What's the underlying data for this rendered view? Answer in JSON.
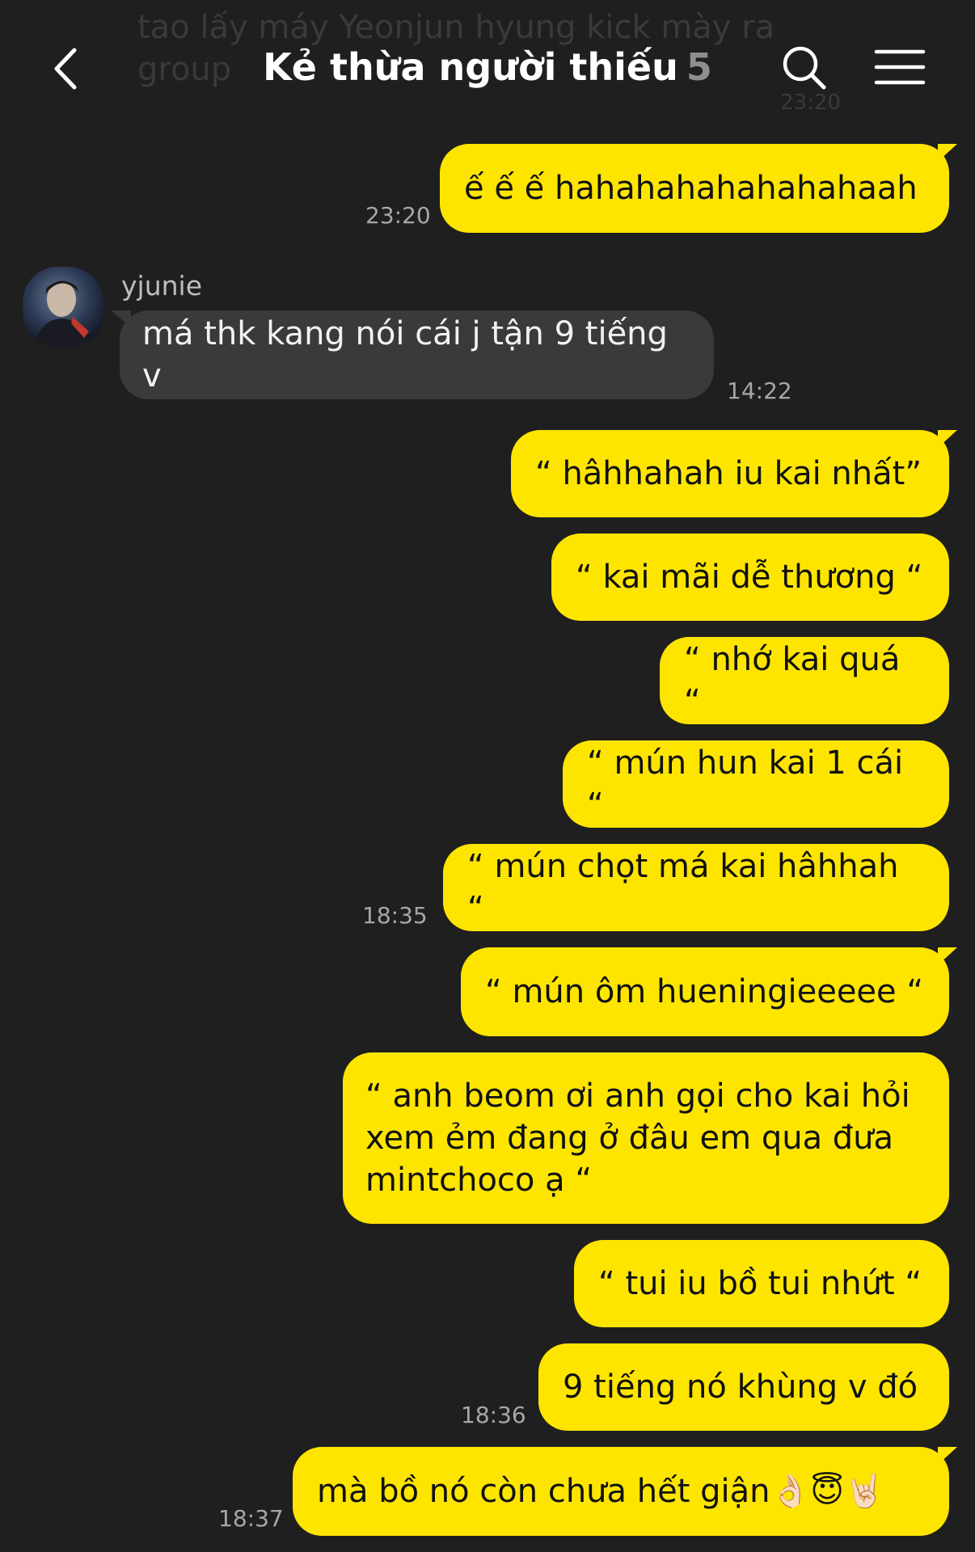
{
  "header": {
    "title": "Kẻ thừa người thiếu",
    "member_count": "5",
    "ghost_text": "tao lấy máy Yeonjun hyung kick mày ra group",
    "ghost_time": "23:20"
  },
  "colors": {
    "background": "#1f1f1f",
    "bubble_out": "#fee500",
    "bubble_in": "#3a3a3a",
    "timestamp": "#a7a7a7"
  },
  "icons": {
    "back": "back-chevron-icon",
    "search": "search-icon",
    "menu": "menu-icon"
  },
  "messages": [
    {
      "text": "ế ế ế hahahahahahahahaah",
      "time": "23:20"
    },
    {
      "sender": "yjunie",
      "text": "má thk kang nói cái j tận 9 tiếng v",
      "time": "14:22"
    },
    {
      "text": "“ hâhhahah iu kai nhất”"
    },
    {
      "text": "“ kai mãi dễ thương “"
    },
    {
      "text": "“ nhớ kai quá “"
    },
    {
      "text": "“ mún hun kai 1 cái “"
    },
    {
      "text": "“ mún chọt má kai hâhhah “",
      "time": "18:35"
    },
    {
      "text": "“ mún ôm hueningieeeee “"
    },
    {
      "text": "“ anh beom ơi anh gọi cho kai hỏi xem ẻm đang ở đâu em qua đưa mintchoco ạ “"
    },
    {
      "text": "“ tui iu bồ tui nhứt “"
    },
    {
      "text": "9 tiếng nó khùng v đó",
      "time": "18:36"
    },
    {
      "text": "mà bồ nó còn chưa hết giận👌🏻😇🤘🏻",
      "time": "18:37"
    }
  ]
}
